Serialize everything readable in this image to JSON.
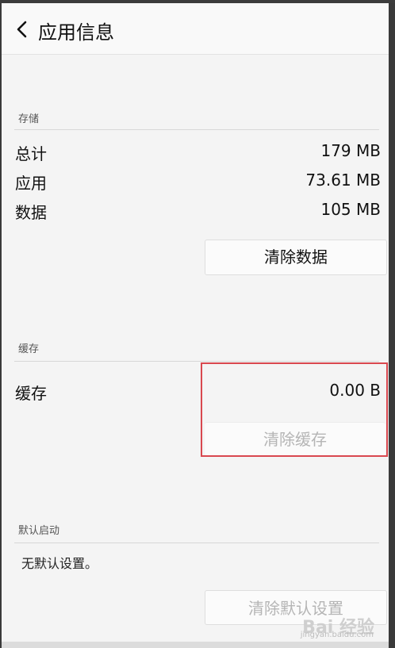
{
  "header": {
    "title": "应用信息"
  },
  "storage": {
    "section_title": "存储",
    "rows": [
      {
        "label": "总计",
        "value": "179 MB"
      },
      {
        "label": "应用",
        "value": "73.61 MB"
      },
      {
        "label": "数据",
        "value": "105 MB"
      }
    ],
    "clear_data_label": "清除数据"
  },
  "cache": {
    "section_title": "缓存",
    "label": "缓存",
    "value": "0.00 B",
    "clear_cache_label": "清除缓存"
  },
  "default_launch": {
    "section_title": "默认启动",
    "note": "无默认设置。",
    "clear_default_label": "清除默认设置"
  },
  "watermark": {
    "text": "Bai 经验",
    "sub": "jingyan.baidu.com"
  },
  "colors": {
    "highlight": "#d9484f",
    "disabled_text": "#b5b5b5"
  }
}
